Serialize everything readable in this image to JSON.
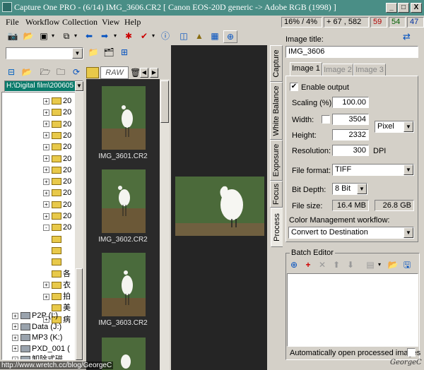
{
  "window": {
    "title": "Capture One PRO  -  (6/14) IMG_3606.CR2  [ Canon EOS-20D generic -> Adobe RGB (1998) ]",
    "minimize": "_",
    "maximize": "□",
    "close": "X"
  },
  "menu": {
    "items": [
      "File",
      "Workflow",
      "Collection",
      "View",
      "Help"
    ]
  },
  "status": {
    "zoom": "16% / 4%",
    "coords": "67 , 582",
    "r": "59",
    "g": "54",
    "b": "47"
  },
  "browser": {
    "path": "H:\\Digital film\\200605",
    "raw_tab": "RAW",
    "tree": [
      {
        "label": "20",
        "type": "folder",
        "expand": "+"
      },
      {
        "label": "20",
        "type": "folder",
        "expand": "+"
      },
      {
        "label": "20",
        "type": "folder",
        "expand": "+"
      },
      {
        "label": "20",
        "type": "folder",
        "expand": "+"
      },
      {
        "label": "20",
        "type": "folder",
        "expand": "+"
      },
      {
        "label": "20",
        "type": "folder",
        "expand": "+"
      },
      {
        "label": "20",
        "type": "folder",
        "expand": "+"
      },
      {
        "label": "20",
        "type": "folder",
        "expand": "+"
      },
      {
        "label": "20",
        "type": "folder",
        "expand": "+"
      },
      {
        "label": "20",
        "type": "folder",
        "expand": "+"
      },
      {
        "label": "20",
        "type": "folder",
        "expand": "+"
      },
      {
        "label": "20",
        "type": "folder",
        "expand": "-"
      },
      {
        "label": "",
        "type": "folder",
        "expand": ""
      },
      {
        "label": "",
        "type": "folder",
        "expand": ""
      },
      {
        "label": "",
        "type": "folder",
        "expand": ""
      },
      {
        "label": "各",
        "type": "folder",
        "expand": ""
      },
      {
        "label": "衣",
        "type": "folder",
        "expand": "+"
      },
      {
        "label": "拍",
        "type": "folder",
        "expand": "+"
      },
      {
        "label": "美",
        "type": "folder",
        "expand": ""
      },
      {
        "label": "病",
        "type": "folder",
        "expand": "+"
      }
    ],
    "drives": [
      {
        "label": "P2P (I:)"
      },
      {
        "label": "Data (J:)"
      },
      {
        "label": "MP3 (K:)"
      },
      {
        "label": "PXD_001 ("
      },
      {
        "label": "卸除式磁"
      }
    ]
  },
  "thumbnails": [
    {
      "name": "IMG_3601.CR2"
    },
    {
      "name": "IMG_3602.CR2"
    },
    {
      "name": "IMG_3603.CR2"
    }
  ],
  "tabs_vertical": [
    "Capture",
    "White Balance",
    "Exposure",
    "Focus",
    "Process"
  ],
  "process": {
    "image_title_label": "Image title:",
    "image_title": "IMG_3606",
    "image_tabs": [
      "Image 1",
      "Image 2",
      "Image 3"
    ],
    "enable_output_label": "Enable output",
    "enable_output": "✔",
    "scaling_label": "Scaling (%):",
    "scaling": "100.00",
    "width_label": "Width:",
    "width": "3504",
    "height_label": "Height:",
    "height": "2332",
    "unit": "Pixel",
    "resolution_label": "Resolution:",
    "resolution": "300",
    "dpi": "DPI",
    "file_format_label": "File format:",
    "file_format": "TIFF",
    "bit_depth_label": "Bit Depth:",
    "bit_depth": "8 Bit",
    "file_size_label": "File size:",
    "file_size_1": "16.4 MB",
    "file_size_2": "26.8 GB",
    "cm_workflow_label": "Color Management workflow:",
    "cm_workflow": "Convert to Destination",
    "batch_editor_label": "Batch Editor",
    "auto_open_label": "Automatically open processed images"
  },
  "watermark": {
    "url": "http://www.wretch.cc/blog/GeorgeC",
    "signature": "GeorgeC"
  }
}
